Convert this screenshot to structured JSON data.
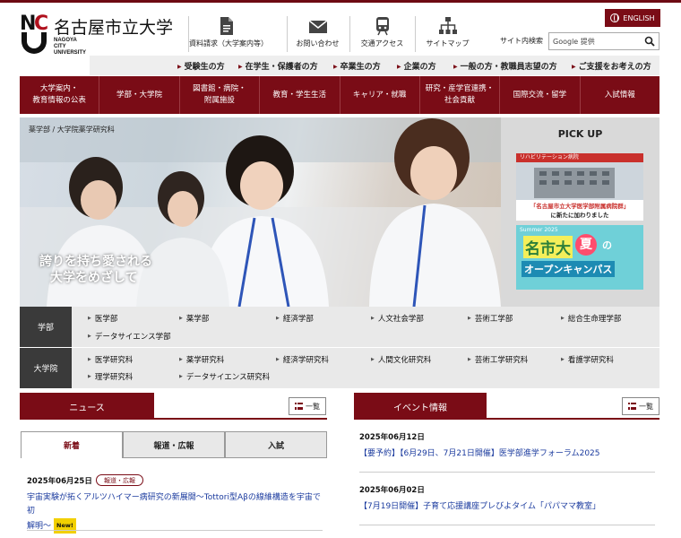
{
  "logo": {
    "name_ja": "名古屋市立大学",
    "name_en_1": "NAGOYA",
    "name_en_2": "CITY",
    "name_en_3": "UNIVERSITY",
    "mark": "NCU"
  },
  "utility": [
    {
      "label": "資料請求（大学案内等）",
      "icon": "document-icon"
    },
    {
      "label": "お問い合わせ",
      "icon": "mail-icon"
    },
    {
      "label": "交通アクセス",
      "icon": "train-icon"
    },
    {
      "label": "サイトマップ",
      "icon": "sitemap-icon"
    }
  ],
  "english": "ENGLISH",
  "search": {
    "label": "サイト内検索",
    "brand": "Google 提供"
  },
  "audience": [
    "受験生の方",
    "在学生・保護者の方",
    "卒業生の方",
    "企業の方",
    "一般の方・教職員志望の方",
    "ご支援をお考えの方"
  ],
  "mainnav": [
    [
      "大学案内・",
      "教育情報の公表"
    ],
    [
      "学部・大学院",
      ""
    ],
    [
      "図書館・病院・",
      "附属施設"
    ],
    [
      "教育・学生生活",
      ""
    ],
    [
      "キャリア・就職",
      ""
    ],
    [
      "研究・産学官連携・",
      "社会貢献"
    ],
    [
      "国際交流・留学",
      ""
    ],
    [
      "入試情報",
      ""
    ]
  ],
  "hero": {
    "breadcrumb": "薬学部 / 大学院薬学研究科",
    "copy_1": "誇りを持ち愛される",
    "copy_2": "大学をめざして"
  },
  "pickup": {
    "title": "PICK UP",
    "card1_tag": "リハビリテーション病院",
    "card1_line1": "「名古屋市立大学医学部附属病院群」",
    "card1_line2": "に新たに加わりました",
    "card2_line1": "名市大",
    "card2_line2": "夏",
    "card2_line3": "の",
    "card2_line4": "オープンキャンパス",
    "card2_small": "Summer 2025"
  },
  "faculties": {
    "head": "学部",
    "items": [
      "医学部",
      "薬学部",
      "経済学部",
      "人文社会学部",
      "芸術工学部",
      "総合生命理学部",
      "データサイエンス学部"
    ]
  },
  "graduate": {
    "head": "大学院",
    "items": [
      "医学研究科",
      "薬学研究科",
      "経済学研究科",
      "人間文化研究科",
      "芸術工学研究科",
      "看護学研究科",
      "理学研究科",
      "データサイエンス研究科"
    ]
  },
  "news": {
    "title": "ニュース",
    "list_label": "一覧",
    "tabs": [
      "新着",
      "報道・広報",
      "入試"
    ],
    "items": [
      {
        "date": "2025年06月25日",
        "badge": "報道・広報",
        "text_1": "宇宙実験が拓くアルツハイマー病研究の新展開〜Tottori型Aβの線維構造を宇宙で初",
        "text_2": "解明〜",
        "new": "New!"
      }
    ]
  },
  "events": {
    "title": "イベント情報",
    "list_label": "一覧",
    "items": [
      {
        "date": "2025年06月12日",
        "text": "【要予約】【6月29日、7月21日開催】医学部進学フォーラム2025"
      },
      {
        "date": "2025年06月02日",
        "text": "【7月19日開催】子育て応援講座プレびよタイム「パパママ教室」"
      }
    ]
  },
  "colors": {
    "brand": "#7a0c16",
    "link": "#1a3a9e",
    "new_badge": "#f2d000"
  }
}
